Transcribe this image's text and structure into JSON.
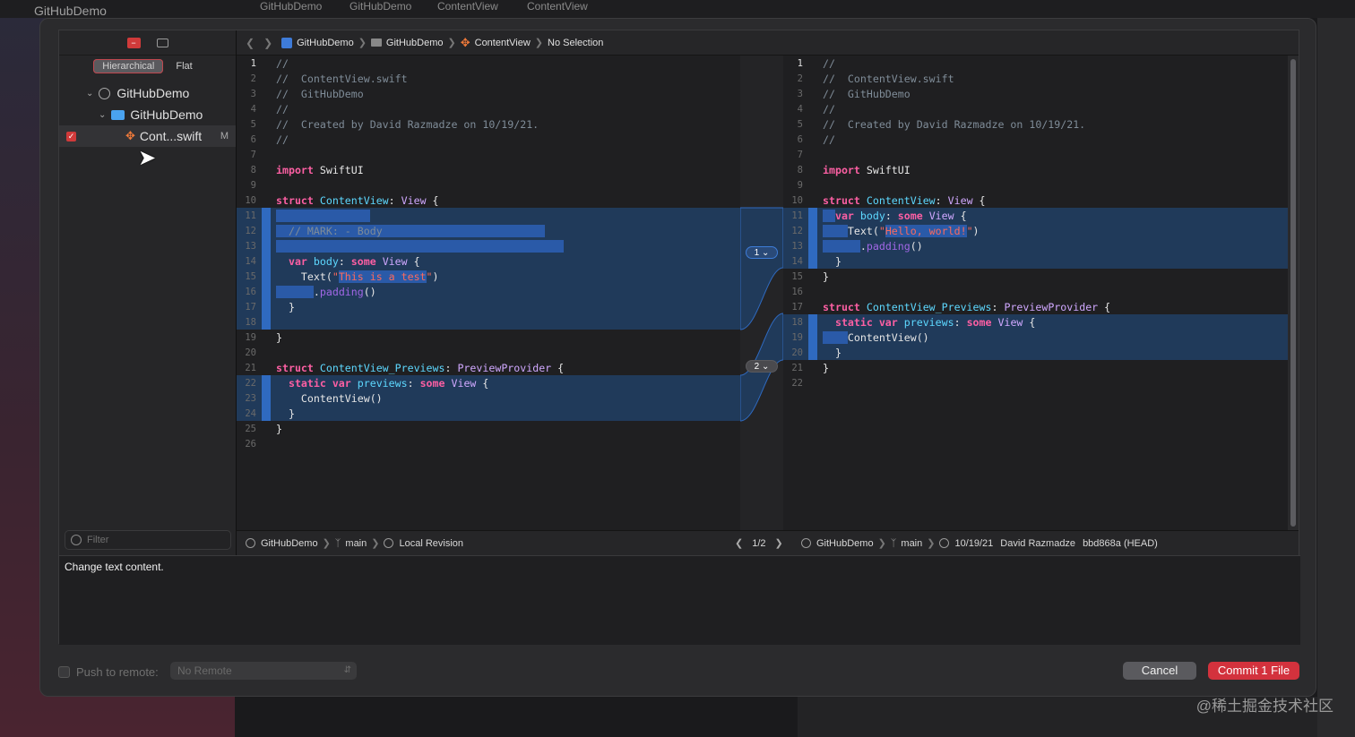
{
  "background": {
    "app_name": "GitHubDemo",
    "top_breadcrumb": [
      "GitHubDemo",
      "GitHubDemo",
      "ContentView",
      "ContentView"
    ],
    "watermark": "@稀土掘金技术社区"
  },
  "sidebar": {
    "seg_hierarchical": "Hierarchical",
    "seg_flat": "Flat",
    "tree": {
      "repo": "GitHubDemo",
      "folder": "GitHubDemo",
      "file": "Cont...swift",
      "file_status": "M"
    },
    "filter_placeholder": "Filter"
  },
  "diff_header": {
    "crumbs": [
      "GitHubDemo",
      "GitHubDemo",
      "ContentView",
      "No Selection"
    ]
  },
  "hunks": [
    "1",
    "2"
  ],
  "status": {
    "left": [
      "GitHubDemo",
      "main",
      "Local Revision"
    ],
    "page": "1/2",
    "right": [
      "GitHubDemo",
      "main",
      "10/19/21",
      "David Razmadze",
      "bbd868a (HEAD)"
    ]
  },
  "commit_message": "Change text content.",
  "footer": {
    "push_label": "Push to remote:",
    "remote_value": "No Remote",
    "cancel": "Cancel",
    "commit": "Commit 1 File"
  },
  "colors": {
    "accent_red": "#d3323d",
    "change_bg": "#203a5a",
    "change_bar": "#2f6ac0"
  }
}
